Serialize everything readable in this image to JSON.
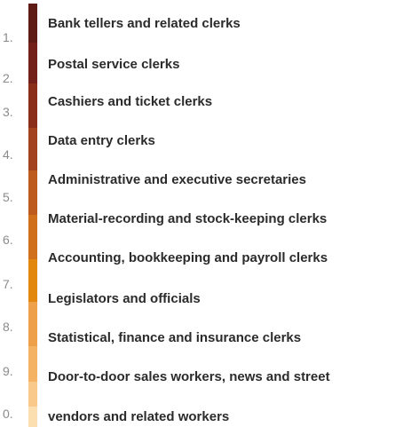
{
  "items": [
    {
      "rank": "1.",
      "label": "Bank tellers and related clerks",
      "color": "#5e1a14"
    },
    {
      "rank": "2.",
      "label": "Postal service clerks",
      "color": "#73201a"
    },
    {
      "rank": "3.",
      "label": "Cashiers and ticket clerks",
      "color": "#8a2e1a"
    },
    {
      "rank": "4.",
      "label": "Data entry clerks",
      "color": "#a3431e"
    },
    {
      "rank": "5.",
      "label": "Administrative and executive secretaries",
      "color": "#bd5a1e"
    },
    {
      "rank": "6.",
      "label": "Material-recording and stock-keeping clerks",
      "color": "#d1701c"
    },
    {
      "rank": "7.",
      "label": "Accounting, bookkeeping and payroll clerks",
      "color": "#e2880f"
    },
    {
      "rank": "8.",
      "label": "Legislators and officials",
      "color": "#efa04a"
    },
    {
      "rank": "9.",
      "label": "Statistical, finance and insurance clerks",
      "color": "#f4b364"
    },
    {
      "rank": "0.",
      "label": "Door-to-door sales workers, news and street vendors and related workers",
      "color": "#f8c98a"
    },
    {
      "rank": "",
      "label": "",
      "color": "#fbdfb0"
    }
  ]
}
